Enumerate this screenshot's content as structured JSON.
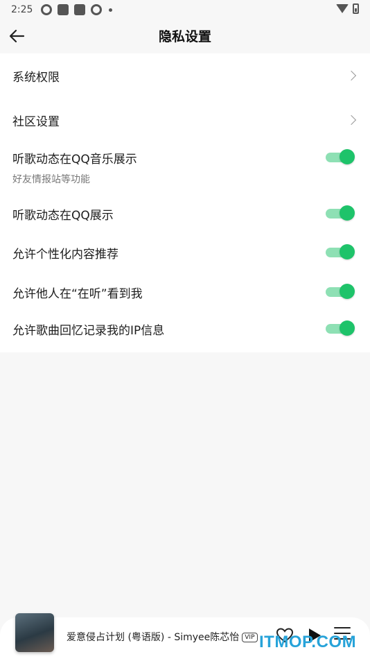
{
  "status_bar": {
    "time": "2:25"
  },
  "header": {
    "title": "隐私设置"
  },
  "settings": [
    {
      "label": "系统权限",
      "type": "nav"
    },
    {
      "label": "社区设置",
      "type": "nav"
    },
    {
      "label": "听歌动态在QQ音乐展示",
      "sublabel": "好友情报站等功能",
      "type": "toggle",
      "enabled": true
    },
    {
      "label": "听歌动态在QQ展示",
      "type": "toggle",
      "enabled": true
    },
    {
      "label": "允许个性化内容推荐",
      "type": "toggle",
      "enabled": true
    },
    {
      "label": "允许他人在“在听”看到我",
      "type": "toggle",
      "enabled": true
    },
    {
      "label": "允许歌曲回忆记录我的IP信息",
      "type": "toggle",
      "enabled": true
    }
  ],
  "player": {
    "song": "爱意侵占计划 (粤语版) - Simyee陈芯怡",
    "badge": "VIP"
  },
  "watermark": "ITMOP.COM",
  "colors": {
    "accent": "#1ec36a",
    "accent_track": "#8ee0b4",
    "background": "#f7f7f7",
    "watermark": "#27a3d9"
  }
}
